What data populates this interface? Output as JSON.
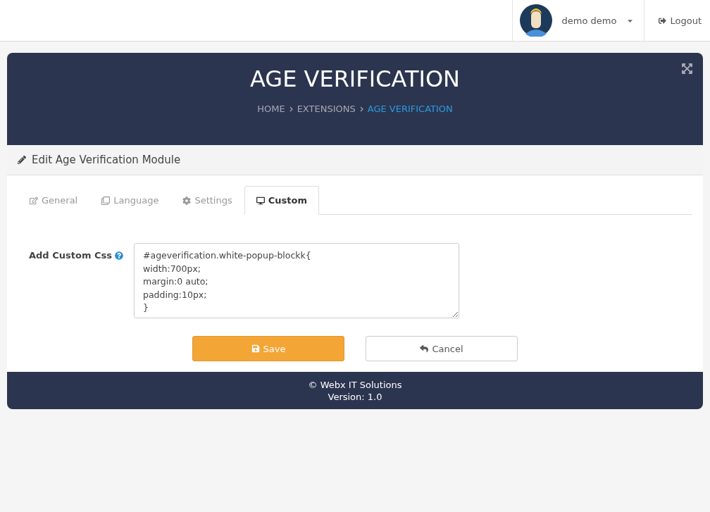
{
  "topbar": {
    "user": "demo demo",
    "logout": "Logout"
  },
  "header": {
    "title": "AGE VERIFICATION",
    "breadcrumb": [
      {
        "label": "HOME",
        "selected": false
      },
      {
        "label": "EXTENSIONS",
        "selected": false
      },
      {
        "label": "AGE VERIFICATION",
        "selected": true
      }
    ]
  },
  "panel": {
    "title": "Edit Age Verification Module"
  },
  "tabs": [
    {
      "label": "General",
      "selected": false
    },
    {
      "label": "Language",
      "selected": false
    },
    {
      "label": "Settings",
      "selected": false
    },
    {
      "label": "Custom",
      "selected": true
    }
  ],
  "form": {
    "label": "Add Custom Css",
    "value": "#ageverification.white-popup-blockk{\nwidth:700px;\nmargin:0 auto;\npadding:10px;\n}"
  },
  "buttons": [
    {
      "label": "Save",
      "kind": "primary"
    },
    {
      "label": "Cancel",
      "kind": "secondary"
    }
  ],
  "footer": {
    "lines": [
      "© Webx IT Solutions",
      "Version: 1.0"
    ]
  }
}
